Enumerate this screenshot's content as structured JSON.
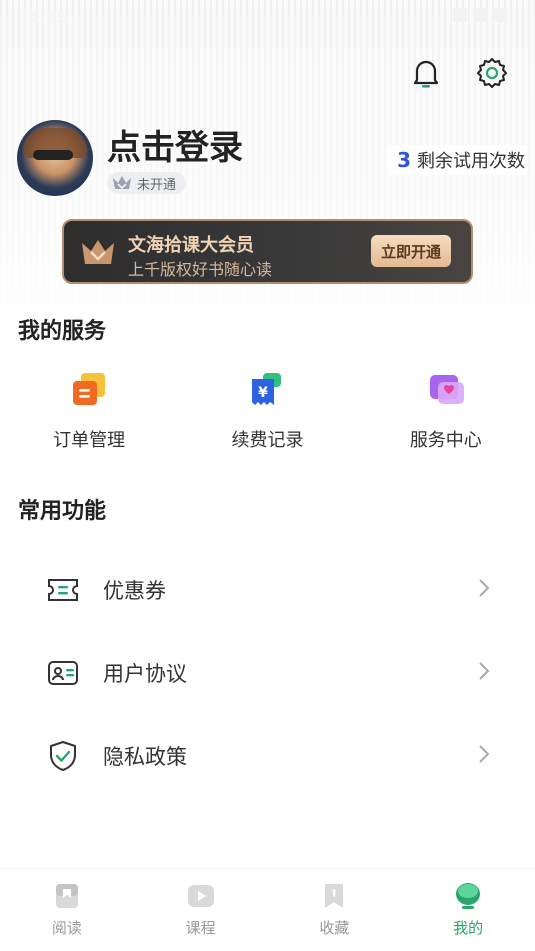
{
  "status_bar": {
    "time": "4:25"
  },
  "profile": {
    "login_text": "点击登录",
    "vip_status": "未开通",
    "trial_count": "3",
    "trial_label": "剩余试用次数"
  },
  "vip_banner": {
    "title": "文海拾课大会员",
    "subtitle": "上千版权好书随心读",
    "button": "立即开通"
  },
  "my_services": {
    "title": "我的服务",
    "items": [
      {
        "label": "订单管理",
        "icon": "order-icon"
      },
      {
        "label": "续费记录",
        "icon": "renewal-icon"
      },
      {
        "label": "服务中心",
        "icon": "service-center-icon"
      }
    ]
  },
  "common_functions": {
    "title": "常用功能",
    "items": [
      {
        "label": "优惠券",
        "icon": "coupon-icon"
      },
      {
        "label": "用户协议",
        "icon": "user-agreement-icon"
      },
      {
        "label": "隐私政策",
        "icon": "privacy-shield-icon"
      }
    ]
  },
  "tabbar": {
    "items": [
      {
        "label": "阅读",
        "icon": "read-icon"
      },
      {
        "label": "课程",
        "icon": "course-play-icon"
      },
      {
        "label": "收藏",
        "icon": "bookmark-icon"
      },
      {
        "label": "我的",
        "icon": "profile-icon"
      }
    ],
    "active": "我的"
  },
  "colors": {
    "accent_green": "#2aa56b",
    "trial_blue": "#2d55d6",
    "vip_gold": "#f0d3b7"
  }
}
